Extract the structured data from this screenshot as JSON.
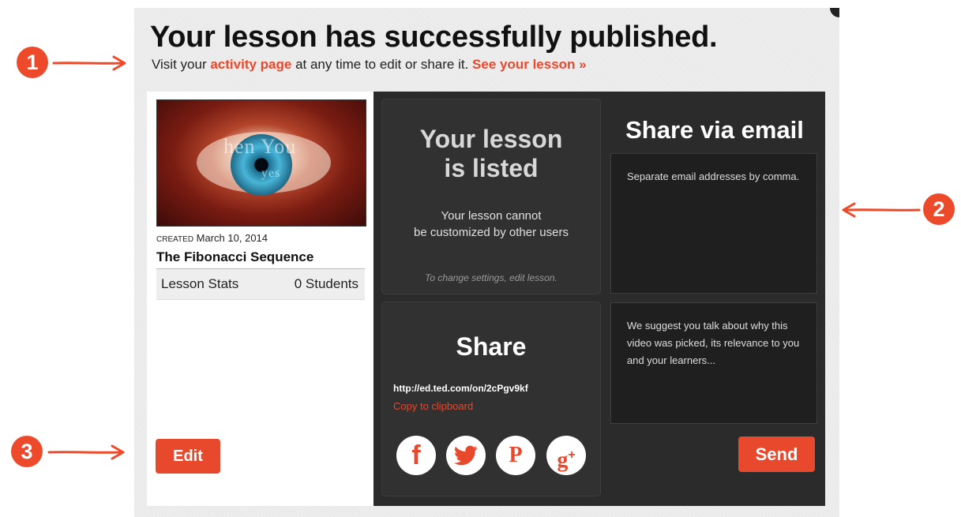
{
  "colors": {
    "accent": "#e8482c",
    "dark_panel": "#2b2b2b",
    "annotation": "#ec4a2a"
  },
  "header": {
    "title": "Your lesson has successfully published.",
    "subtitle_prefix": "Visit your",
    "activity_link": "activity page",
    "subtitle_middle": "at any time to edit or share it.",
    "see_lesson_link": "See your lesson »"
  },
  "lesson": {
    "thumbnail_overlay_text": "hen You",
    "thumbnail_overlay_text2": "yes",
    "created_label": "CREATED",
    "created_date": "March 10, 2014",
    "title": "The Fibonacci Sequence",
    "stats_label": "Lesson Stats",
    "students": "0 Students",
    "edit_label": "Edit"
  },
  "listing": {
    "heading_line1": "Your lesson",
    "heading_line2": "is listed",
    "body_line1": "Your lesson cannot",
    "body_line2": "be customized by other users",
    "note": "To change settings, edit lesson."
  },
  "share": {
    "heading": "Share",
    "url": "http://ed.ted.com/on/2cPgv9kf",
    "copy_label": "Copy to clipboard",
    "social_icons": [
      "facebook-icon",
      "twitter-icon",
      "pinterest-icon",
      "google-plus-icon"
    ],
    "facebook_glyph": "f",
    "pinterest_glyph": "P",
    "googleplus_glyph": "g",
    "googleplus_sup": "+"
  },
  "email": {
    "heading": "Share via email",
    "addresses_placeholder": "Separate email addresses by comma.",
    "message_placeholder": "We suggest you talk about why this video was picked, its relevance to you and your learners...",
    "send_label": "Send"
  },
  "annotations": [
    "1",
    "2",
    "3"
  ]
}
